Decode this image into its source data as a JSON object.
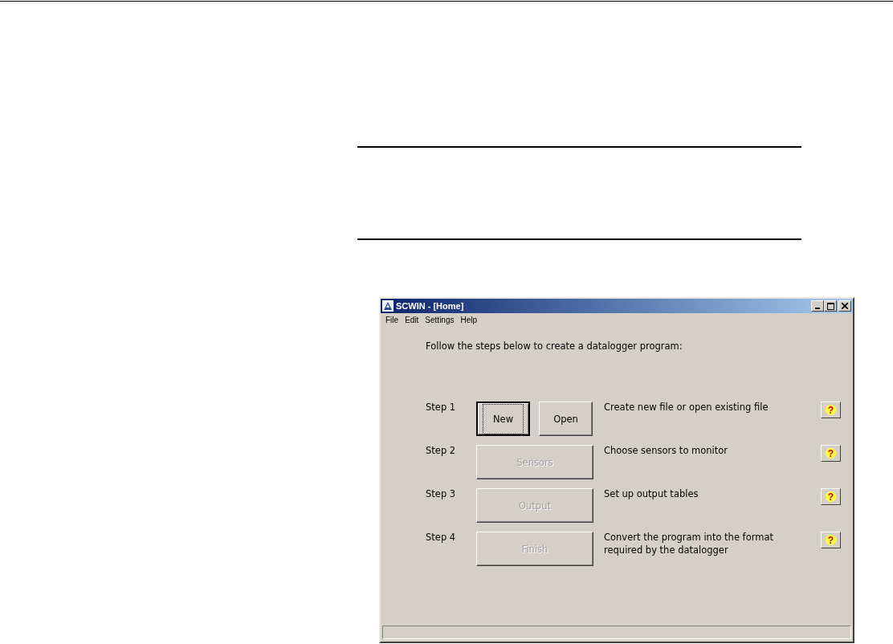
{
  "window": {
    "title": "SCWIN - [Home]"
  },
  "menu": [
    "File",
    "Edit",
    "Settings",
    "Help"
  ],
  "intro": "Follow the steps below to create a datalogger program:",
  "steps": [
    {
      "label": "Step 1",
      "buttons": [
        {
          "label": "New",
          "default": true,
          "disabled": false
        },
        {
          "label": "Open",
          "default": false,
          "disabled": false
        }
      ],
      "description": "Create new file or open existing file",
      "help": "?"
    },
    {
      "label": "Step 2",
      "buttons": [
        {
          "label": "Sensors",
          "default": false,
          "disabled": true
        }
      ],
      "description": "Choose sensors to monitor",
      "help": "?"
    },
    {
      "label": "Step 3",
      "buttons": [
        {
          "label": "Output",
          "default": false,
          "disabled": true
        }
      ],
      "description": "Set up output tables",
      "help": "?"
    },
    {
      "label": "Step 4",
      "buttons": [
        {
          "label": "Finish",
          "default": false,
          "disabled": true
        }
      ],
      "description": "Convert the program into the format required by the datalogger",
      "help": "?"
    }
  ]
}
